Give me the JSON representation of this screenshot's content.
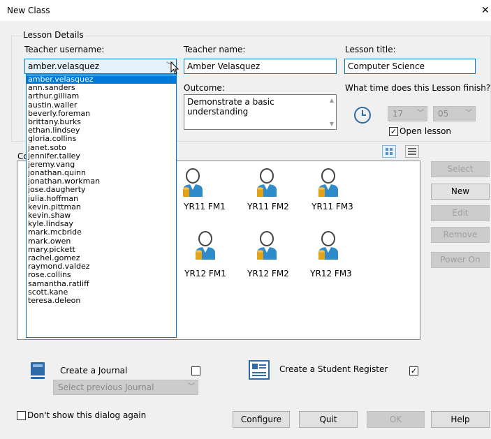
{
  "window": {
    "title": "New Class",
    "close_glyph": "✕"
  },
  "lesson_details": {
    "group_label": "Lesson Details",
    "teacher_username_label": "Teacher username:",
    "teacher_username_value": "amber.velasquez",
    "teacher_name_label": "Teacher name:",
    "teacher_name_value": "Amber Velasquez",
    "lesson_title_label": "Lesson title:",
    "lesson_title_value": "Computer Science",
    "outcome_label": "Outcome:",
    "outcome_value": "Demonstrate a basic understanding",
    "finish_label": "What time does this Lesson finish?",
    "hour": "17",
    "minute": "05",
    "open_lesson_label": "Open lesson",
    "open_lesson_checked": true
  },
  "username_dropdown": {
    "selected_index": 0,
    "items": [
      "amber.velasquez",
      "ann.sanders",
      "arthur.gilliam",
      "austin.waller",
      "beverly.foreman",
      "brittany.burks",
      "ethan.lindsey",
      "gloria.collins",
      "janet.soto",
      "jennifer.talley",
      "jeremy.vang",
      "jonathan.quinn",
      "jonathan.workman",
      "jose.daugherty",
      "julia.hoffman",
      "kevin.pittman",
      "kevin.shaw",
      "kyle.lindsay",
      "mark.mcbride",
      "mark.owen",
      "mary.pickett",
      "rachel.gomez",
      "raymond.valdez",
      "rose.collins",
      "samantha.ratliff",
      "scott.kane",
      "teresa.deleon"
    ]
  },
  "partial_labels": {
    "outcome_side": "C",
    "panel_side": "Co",
    "row1_side": "(",
    "row2_side": "("
  },
  "classes": {
    "row1": [
      "YR11 FM1",
      "YR11 FM2",
      "YR11 FM3"
    ],
    "row2": [
      "YR12 FM1",
      "YR12 FM2",
      "YR12 FM3"
    ]
  },
  "side_buttons": {
    "select": "Select",
    "new": "New",
    "edit": "Edit",
    "remove": "Remove",
    "power_on": "Power On"
  },
  "journal": {
    "label": "Create a Journal",
    "checked": false,
    "select_placeholder": "Select previous Journal"
  },
  "register": {
    "label": "Create a Student Register",
    "checked": true
  },
  "footer": {
    "dont_show_label": "Don't show this dialog again",
    "configure": "Configure",
    "quit": "Quit",
    "ok": "OK",
    "help": "Help"
  },
  "colors": {
    "accent": "#0078d7",
    "icon_blue": "#2f8bc9",
    "icon_gold": "#e3a21a"
  }
}
